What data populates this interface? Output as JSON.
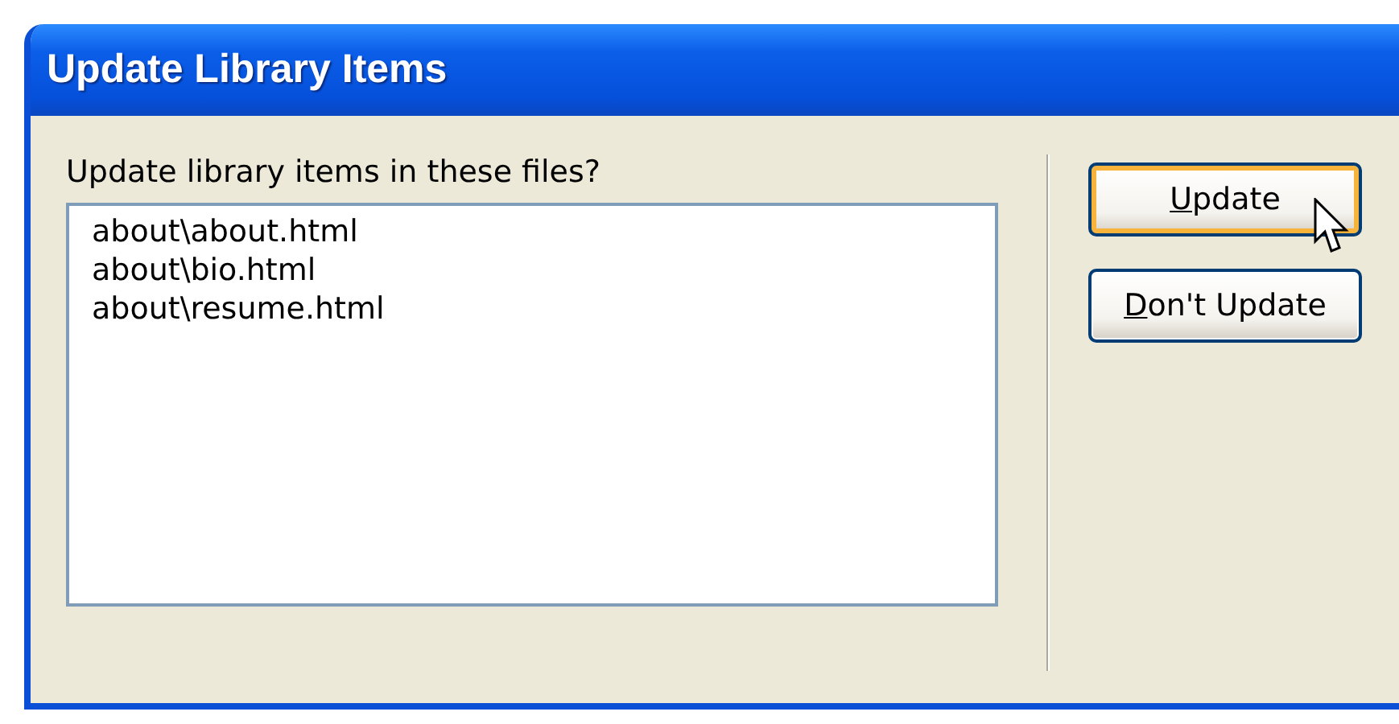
{
  "window": {
    "title": "Update Library Items"
  },
  "prompt": "Update library items in these files?",
  "files": [
    "about\\about.html",
    "about\\bio.html",
    "about\\resume.html"
  ],
  "buttons": [
    {
      "label": "Update",
      "default": true
    },
    {
      "label": "Don't Update",
      "default": false
    }
  ]
}
